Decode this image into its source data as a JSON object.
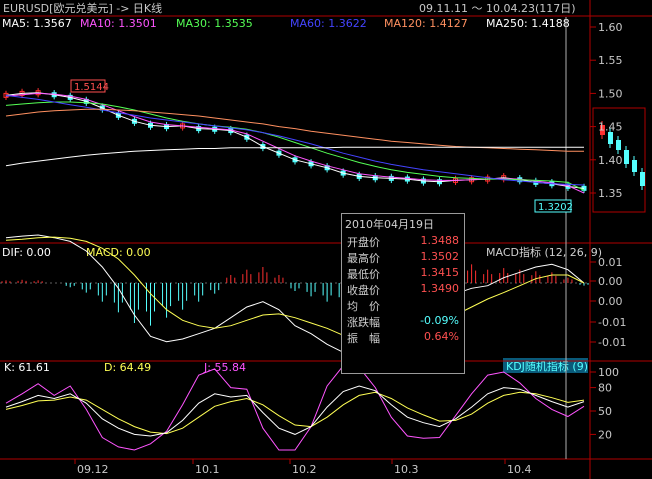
{
  "header": {
    "symbol": "EURUSD[欧元兑美元] -> 日K线",
    "range": "09.11.11 ～ 10.04.23(117日)"
  },
  "main_panel": {
    "ma_labels": [
      {
        "text": "MA5: 1.3567",
        "color": "#ffffff"
      },
      {
        "text": "MA10: 1.3501",
        "color": "#ff55ff"
      },
      {
        "text": "MA30: 1.3535",
        "color": "#55ff55"
      },
      {
        "text": "MA60: 1.3622",
        "color": "#4444ff"
      },
      {
        "text": "MA120: 1.4127",
        "color": "#ff9060"
      },
      {
        "text": "MA250: 1.4188",
        "color": "#ffffff"
      }
    ],
    "high_label": "1.5144",
    "low_label": "1.3202",
    "y_ticks": [
      "1.60",
      "1.55",
      "1.50",
      "1.45",
      "1.40",
      "1.35"
    ]
  },
  "macd_panel": {
    "labels": [
      {
        "text": "DIF: 0.00",
        "color": "#ffffff"
      },
      {
        "text": "MACD: 0.00",
        "color": "#ffff55"
      }
    ],
    "indicator_name": "MACD指标 (12, 26, 9)",
    "y_ticks": [
      "0.01",
      "0.00",
      "0.00",
      "-0.01",
      "-0.01"
    ]
  },
  "kdj_panel": {
    "labels": [
      {
        "text": "K: 61.61",
        "color": "#ffffff"
      },
      {
        "text": "D: 64.49",
        "color": "#ffff55"
      },
      {
        "text": "J: 55.84",
        "color": "#ff55ff"
      }
    ],
    "indicator_name": "KDJ随机指标 (9)",
    "y_ticks": [
      "100",
      "80",
      "50",
      "20"
    ]
  },
  "x_ticks": [
    "09.12",
    "10.1",
    "10.2",
    "10.3",
    "10.4"
  ],
  "popup": {
    "date": "2010年04月19日",
    "rows": [
      {
        "label": "开盘价",
        "value": "1.3488",
        "color": "#ff5050"
      },
      {
        "label": "最高价",
        "value": "1.3502",
        "color": "#ff5050"
      },
      {
        "label": "最低价",
        "value": "1.3415",
        "color": "#ff5050"
      },
      {
        "label": "收盘价",
        "value": "1.3490",
        "color": "#ff5050"
      },
      {
        "label": "均　价",
        "value": "",
        "color": "#ff5050"
      },
      {
        "label": "涨跌幅",
        "value": "-0.09%",
        "color": "#55ffff"
      },
      {
        "label": "振　幅",
        "value": "0.64%",
        "color": "#ff5050"
      }
    ]
  },
  "chart_data": {
    "type": "line",
    "title": "EURUSD[欧元兑美元] -> 日K线",
    "x_categories": [
      "09.12",
      "10.1",
      "10.2",
      "10.3",
      "10.4"
    ],
    "price_axis": [
      1.35,
      1.6
    ],
    "series": [
      {
        "name": "MA5",
        "color": "#ffffff",
        "values": [
          1.497,
          1.5,
          1.501,
          1.498,
          1.494,
          1.488,
          1.478,
          1.467,
          1.458,
          1.452,
          1.45,
          1.451,
          1.447,
          1.446,
          1.444,
          1.434,
          1.42,
          1.41,
          1.4,
          1.394,
          1.388,
          1.38,
          1.375,
          1.373,
          1.372,
          1.371,
          1.368,
          1.367,
          1.369,
          1.37,
          1.371,
          1.373,
          1.37,
          1.366,
          1.364,
          1.36,
          1.357
        ]
      },
      {
        "name": "MA10",
        "color": "#ff55ff",
        "values": [
          1.496,
          1.498,
          1.5,
          1.499,
          1.496,
          1.491,
          1.483,
          1.474,
          1.465,
          1.457,
          1.453,
          1.451,
          1.449,
          1.447,
          1.445,
          1.439,
          1.428,
          1.417,
          1.406,
          1.398,
          1.391,
          1.385,
          1.379,
          1.376,
          1.374,
          1.372,
          1.37,
          1.369,
          1.369,
          1.37,
          1.371,
          1.372,
          1.371,
          1.368,
          1.365,
          1.361,
          1.35
        ]
      },
      {
        "name": "MA30",
        "color": "#55ff55",
        "values": [
          1.482,
          1.484,
          1.486,
          1.487,
          1.487,
          1.486,
          1.484,
          1.48,
          1.475,
          1.469,
          1.463,
          1.458,
          1.454,
          1.451,
          1.449,
          1.446,
          1.441,
          1.434,
          1.426,
          1.418,
          1.41,
          1.403,
          1.396,
          1.39,
          1.385,
          1.381,
          1.378,
          1.375,
          1.373,
          1.372,
          1.371,
          1.371,
          1.37,
          1.369,
          1.368,
          1.366,
          1.354
        ]
      },
      {
        "name": "MA60",
        "color": "#4444ff",
        "values": [
          1.497,
          1.494,
          1.491,
          1.487,
          1.483,
          1.479,
          1.475,
          1.471,
          1.467,
          1.463,
          1.46,
          1.457,
          1.454,
          1.451,
          1.448,
          1.445,
          1.441,
          1.436,
          1.43,
          1.424,
          1.417,
          1.41,
          1.404,
          1.398,
          1.393,
          1.389,
          1.385,
          1.382,
          1.379,
          1.376,
          1.373,
          1.37,
          1.368,
          1.366,
          1.364,
          1.363,
          1.362
        ]
      },
      {
        "name": "MA120",
        "color": "#ff9060",
        "values": [
          1.466,
          1.469,
          1.472,
          1.474,
          1.475,
          1.476,
          1.476,
          1.475,
          1.474,
          1.472,
          1.47,
          1.468,
          1.466,
          1.463,
          1.46,
          1.457,
          1.454,
          1.45,
          1.447,
          1.443,
          1.44,
          1.437,
          1.434,
          1.431,
          1.428,
          1.426,
          1.424,
          1.422,
          1.42,
          1.419,
          1.418,
          1.417,
          1.416,
          1.415,
          1.414,
          1.413,
          1.413
        ]
      },
      {
        "name": "MA250",
        "color": "#ffffff",
        "values": [
          1.391,
          1.395,
          1.398,
          1.401,
          1.404,
          1.407,
          1.409,
          1.411,
          1.413,
          1.414,
          1.415,
          1.416,
          1.417,
          1.417,
          1.418,
          1.418,
          1.418,
          1.418,
          1.418,
          1.418,
          1.418,
          1.419,
          1.419,
          1.419,
          1.419,
          1.419,
          1.419,
          1.419,
          1.419,
          1.419,
          1.419,
          1.419,
          1.419,
          1.419,
          1.419,
          1.419,
          1.419
        ]
      }
    ],
    "macd": {
      "axis": [
        -0.015,
        0.015
      ],
      "dif": [
        0.0085,
        0.0088,
        0.009,
        0.0085,
        0.0078,
        0.006,
        0.003,
        -0.001,
        -0.006,
        -0.01,
        -0.011,
        -0.0105,
        -0.0095,
        -0.0085,
        -0.0065,
        -0.0045,
        -0.0035,
        -0.005,
        -0.008,
        -0.0095,
        -0.0115,
        -0.013,
        -0.0135,
        -0.012,
        -0.01,
        -0.008,
        -0.006,
        -0.004,
        -0.002,
        -0.001,
        -0.0005,
        0.001,
        0.002,
        0.003,
        0.0035,
        0.0025,
        0.0
      ],
      "dea": [
        0.008,
        0.0082,
        0.0085,
        0.0086,
        0.0084,
        0.0078,
        0.0065,
        0.0045,
        0.0015,
        -0.002,
        -0.005,
        -0.007,
        -0.008,
        -0.0085,
        -0.008,
        -0.007,
        -0.006,
        -0.0058,
        -0.0065,
        -0.0075,
        -0.0085,
        -0.0098,
        -0.0108,
        -0.0112,
        -0.011,
        -0.01,
        -0.0088,
        -0.0075,
        -0.006,
        -0.0045,
        -0.003,
        -0.0018,
        -0.0005,
        0.0008,
        0.0015,
        0.0015,
        0.0
      ],
      "hist": [
        0.0005,
        0.0006,
        0.0005,
        0.0,
        -0.0008,
        -0.0018,
        -0.0035,
        -0.0055,
        -0.0075,
        -0.008,
        -0.0065,
        -0.005,
        -0.0035,
        -0.002,
        0.0015,
        0.0025,
        0.003,
        0.0015,
        -0.0015,
        -0.0025,
        -0.0035,
        -0.004,
        -0.0035,
        -0.0015,
        0.001,
        0.002,
        0.0028,
        0.0035,
        0.004,
        0.0035,
        0.0025,
        0.0028,
        0.0025,
        0.0022,
        0.002,
        0.001,
        -0.0005
      ]
    },
    "kdj": {
      "axis": [
        0,
        100
      ],
      "k": [
        55,
        62,
        70,
        66,
        72,
        60,
        40,
        28,
        20,
        18,
        22,
        38,
        60,
        72,
        68,
        70,
        48,
        28,
        20,
        30,
        55,
        75,
        82,
        76,
        58,
        42,
        35,
        30,
        40,
        55,
        72,
        80,
        78,
        70,
        62,
        55,
        62
      ],
      "d": [
        52,
        57,
        63,
        64,
        68,
        64,
        52,
        40,
        30,
        23,
        21,
        28,
        42,
        56,
        62,
        66,
        58,
        44,
        32,
        30,
        42,
        58,
        70,
        74,
        66,
        54,
        45,
        37,
        38,
        46,
        60,
        70,
        74,
        72,
        67,
        61,
        64
      ],
      "j": [
        60,
        72,
        85,
        70,
        82,
        52,
        16,
        4,
        0,
        8,
        24,
        58,
        96,
        104,
        80,
        78,
        28,
        0,
        0,
        30,
        82,
        108,
        106,
        80,
        42,
        18,
        15,
        16,
        44,
        72,
        96,
        100,
        86,
        66,
        52,
        43,
        56
      ]
    }
  }
}
